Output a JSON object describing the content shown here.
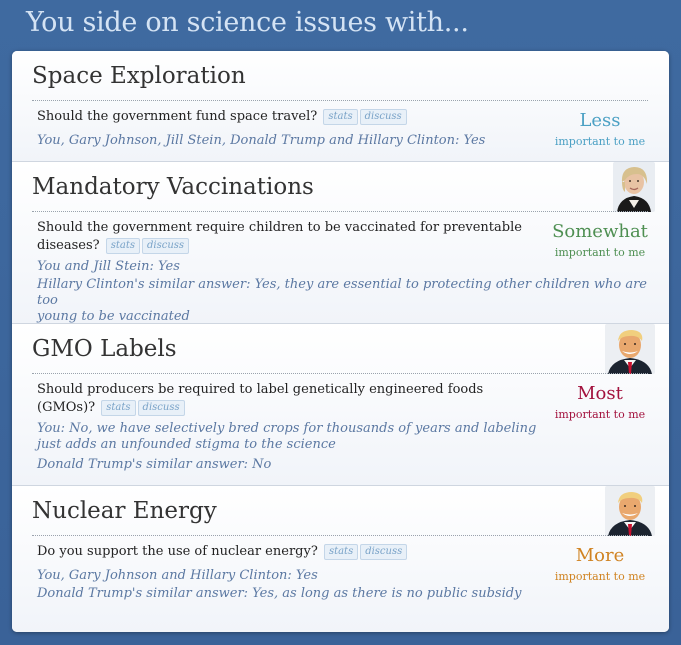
{
  "header": {
    "title": "You side on science issues with..."
  },
  "pills": {
    "stats": "stats",
    "discuss": "discuss"
  },
  "sections": [
    {
      "title": "Space Exploration",
      "question": "Should the government fund space travel?",
      "answers": [
        "You, Gary Johnson, Jill Stein, Donald Trump and Hillary Clinton: Yes"
      ],
      "importance": {
        "level": "Less",
        "sub": "important to me",
        "color": "#4ba0c4"
      }
    },
    {
      "title": "Mandatory Vaccinations",
      "question_lines": [
        "Should the government require children to be vaccinated for preventable",
        "diseases?"
      ],
      "answers": [
        "You and Jill Stein: Yes",
        "Hillary Clinton's similar answer: Yes, they are essential to protecting other children who are too",
        "young to be vaccinated"
      ],
      "importance": {
        "level": "Somewhat",
        "sub": "important to me",
        "color": "#4e8f52"
      },
      "avatar": "hillary-clinton-avatar"
    },
    {
      "title": "GMO Labels",
      "question_lines": [
        "Should producers be required to label genetically engineered foods",
        "(GMOs)?"
      ],
      "answers": [
        "You: No, we have selectively bred crops for thousands of years and labeling",
        "just adds an unfounded stigma to the science",
        "Donald Trump's similar answer: No"
      ],
      "importance": {
        "level": "Most",
        "sub": "important to me",
        "color": "#a3123e"
      },
      "avatar": "donald-trump-avatar"
    },
    {
      "title": "Nuclear Energy",
      "question": "Do you support the use of nuclear energy?",
      "answers": [
        "You, Gary Johnson and Hillary Clinton: Yes",
        "Donald Trump's similar answer: Yes, as long as there is no public subsidy"
      ],
      "importance": {
        "level": "More",
        "sub": "important to me",
        "color": "#d08322"
      },
      "avatar": "donald-trump-avatar"
    }
  ]
}
